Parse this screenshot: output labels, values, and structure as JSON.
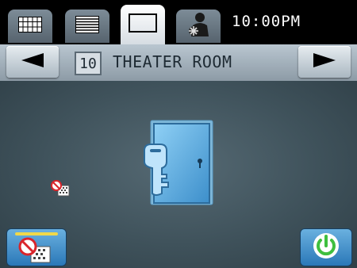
{
  "header": {
    "tabs": [
      {
        "icon": "grid-icon"
      },
      {
        "icon": "list-icon"
      },
      {
        "icon": "single-view-icon",
        "active": true
      },
      {
        "icon": "person-settings-icon"
      }
    ],
    "clock": "10:00PM"
  },
  "room": {
    "number": "10",
    "name": "THEATER ROOM",
    "prev_icon": "left-arrow-icon",
    "next_icon": "right-arrow-icon"
  },
  "main": {
    "device_icon": "door-key-lock-icon",
    "status_icon": "no-disturb-icon"
  },
  "footer": {
    "left_button_icon": "no-disturb-icon",
    "power_icon": "power-icon"
  },
  "colors": {
    "accent_blue": "#3b8fcf",
    "power_green": "#3fbf3f",
    "no_symbol_red": "#d9252b",
    "indicator_yellow": "#f0d84a"
  }
}
